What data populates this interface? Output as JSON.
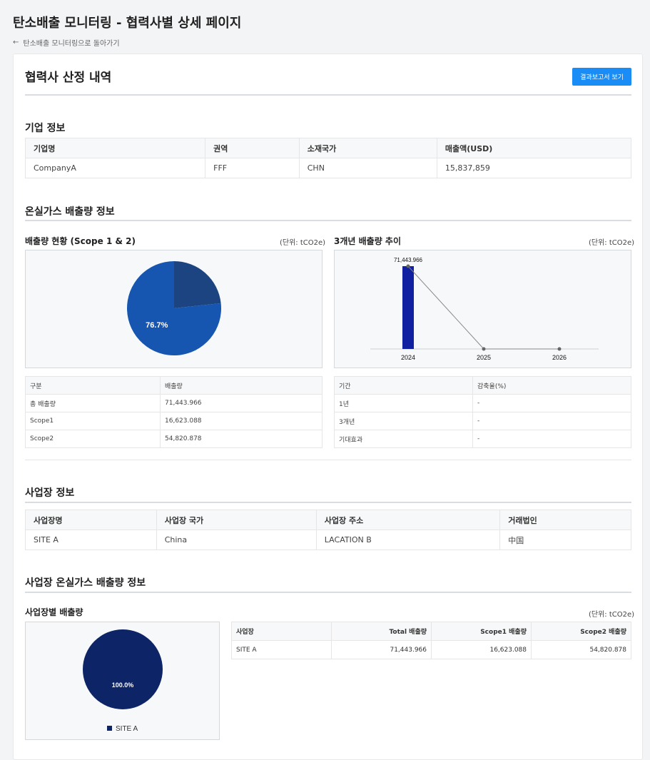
{
  "header": {
    "title": "탄소배출 모니터링 - 협력사별 상세 페이지",
    "back_link": "탄소배출 모니터링으로 돌아가기"
  },
  "card": {
    "title": "협력사 산정 내역",
    "report_button": "결과보고서 보기"
  },
  "company": {
    "title": "기업 정보",
    "headers": [
      "기업명",
      "권역",
      "소재국가",
      "매출액(USD)"
    ],
    "row": [
      "CompanyA",
      "FFF",
      "CHN",
      "15,837,859"
    ]
  },
  "ghg": {
    "title": "온실가스 배출량 정보",
    "status_title": "배출량 현황 (Scope 1 & 2)",
    "trend_title": "3개년 배출량 추이",
    "unit": "(단위: tCO2e)",
    "status_table": {
      "headers": [
        "구분",
        "배출량"
      ],
      "rows": [
        [
          "총 배출량",
          "71,443.966"
        ],
        [
          "Scope1",
          "16,623.088"
        ],
        [
          "Scope2",
          "54,820.878"
        ]
      ]
    },
    "trend_table": {
      "headers": [
        "기간",
        "감축율(%)"
      ],
      "rows": [
        [
          "1년",
          "-"
        ],
        [
          "3개년",
          "-"
        ],
        [
          "기대효과",
          "-"
        ]
      ]
    }
  },
  "site": {
    "title": "사업장 정보",
    "headers": [
      "사업장명",
      "사업장 국가",
      "사업장 주소",
      "거래법인"
    ],
    "row": [
      "SITE A",
      "China",
      "LACATION B",
      "中国"
    ]
  },
  "site_ghg": {
    "title": "사업장 온실가스 배출량 정보",
    "sub_title": "사업장별 배출량",
    "unit": "(단위: tCO2e)",
    "table": {
      "headers": [
        "사업장",
        "Total 배출량",
        "Scope1 배출량",
        "Scope2 배출량"
      ],
      "rows": [
        [
          "SITE A",
          "71,443.966",
          "16,623.088",
          "54,820.878"
        ]
      ]
    }
  },
  "chart_data": [
    {
      "type": "pie",
      "categories": [
        "Scope1",
        "Scope2"
      ],
      "values": [
        16623.088,
        54820.878
      ],
      "data_labels": [
        "",
        "76.7%"
      ],
      "colors": [
        "#1b4480",
        "#1655b0"
      ]
    },
    {
      "type": "bar",
      "categories": [
        "2024",
        "2025",
        "2026"
      ],
      "values": [
        71443.966,
        0,
        0
      ],
      "data_labels": [
        "71,443.966",
        "",
        ""
      ],
      "bar_color": "#1020a0",
      "line_color": "#888888"
    },
    {
      "type": "pie",
      "categories": [
        "SITE A"
      ],
      "values": [
        71443.966
      ],
      "data_labels": [
        "100.0%"
      ],
      "legend": [
        "SITE A"
      ],
      "legend_position": "bottom",
      "colors": [
        "#0d2466"
      ]
    }
  ]
}
